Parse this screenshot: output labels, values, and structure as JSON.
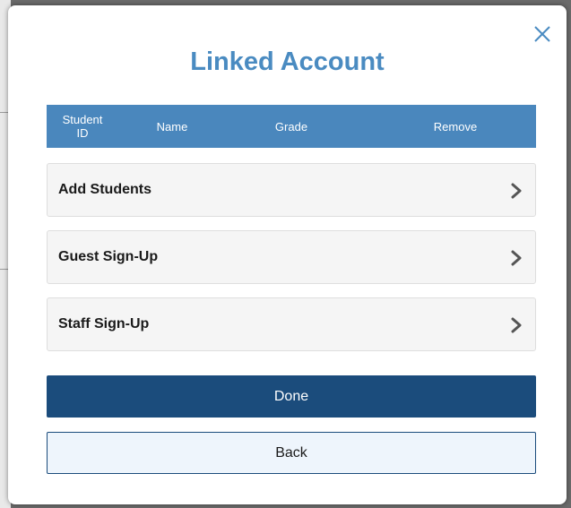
{
  "modal": {
    "title": "Linked Account",
    "close_icon": "close-icon"
  },
  "table": {
    "headers": [
      {
        "line1": "Student",
        "line2": "ID"
      },
      {
        "line1": "Name"
      },
      {
        "line1": "Grade"
      },
      {
        "line1": "Remove"
      }
    ]
  },
  "options": [
    {
      "label": "Add Students",
      "icon": "chevron-right-icon"
    },
    {
      "label": "Guest Sign-Up",
      "icon": "chevron-right-icon"
    },
    {
      "label": "Staff Sign-Up",
      "icon": "chevron-right-icon"
    }
  ],
  "buttons": {
    "done_label": "Done",
    "back_label": "Back"
  },
  "colors": {
    "title": "#4a8bc1",
    "header_bg": "#4a87bd",
    "primary": "#1b4c7c",
    "secondary_bg": "#eef5fc"
  }
}
